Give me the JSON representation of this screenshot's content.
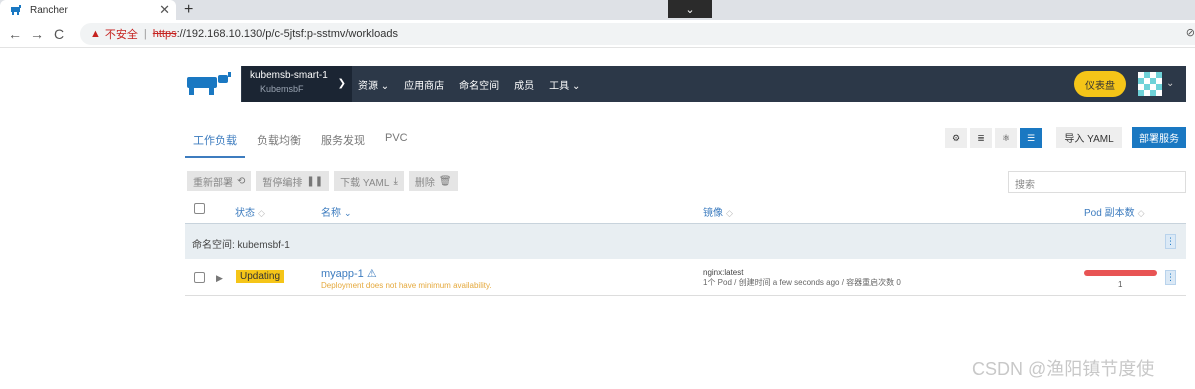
{
  "browser": {
    "tab_title": "Rancher",
    "tab_close": "✕",
    "new_tab": "+",
    "tab_menu": "⌄",
    "back": "←",
    "forward": "→",
    "reload": "C",
    "security_warning": "▲",
    "insecure_label": "不安全",
    "separator": "|",
    "url_scheme": "https",
    "url_rest": "://192.168.10.130/p/c-5jtsf:p-sstmv/workloads",
    "edge_icon": "⊘"
  },
  "header": {
    "cluster_name": "kubemsb-smart-1",
    "project_name": "KubemsbF",
    "nav": [
      "资源 ⌄",
      "应用商店",
      "命名空间",
      "成员",
      "工具 ⌄"
    ],
    "dashboard_button": "仪表盘",
    "avatar_chevron": "⌄"
  },
  "subtabs": [
    "工作负载",
    "负载均衡",
    "服务发现",
    "PVC"
  ],
  "view_buttons": [
    "⚙",
    "≣",
    "⚛",
    "☰"
  ],
  "import_yaml": "导入 YAML",
  "deploy_button": "部署服务",
  "actions": {
    "redeploy": "重新部署",
    "redeploy_icon": "⟲",
    "pause": "暂停编排",
    "pause_icon": "❚❚",
    "download": "下载 YAML",
    "download_icon": "⤓",
    "delete": "删除",
    "delete_icon": "🗑"
  },
  "search_placeholder": "搜索",
  "table": {
    "headers": {
      "state": "状态",
      "name": "名称",
      "image": "镜像",
      "pods": "Pod 副本数"
    },
    "sort_icon": "◇",
    "namespace_label": "命名空间: kubemsbf-1",
    "row": {
      "state": "Updating",
      "name": "myapp-1",
      "name_icon": "⚠",
      "warning": "Deployment does not have minimum availability.",
      "image": "nginx:latest",
      "details": "1个 Pod / 创建时间 a few seconds ago / 容器重启次数 0",
      "pod_count": "1",
      "pod_ready_fraction": 0
    },
    "kebab": "⋮",
    "expander": "▶"
  },
  "watermark": "CSDN @渔阳镇节度使"
}
